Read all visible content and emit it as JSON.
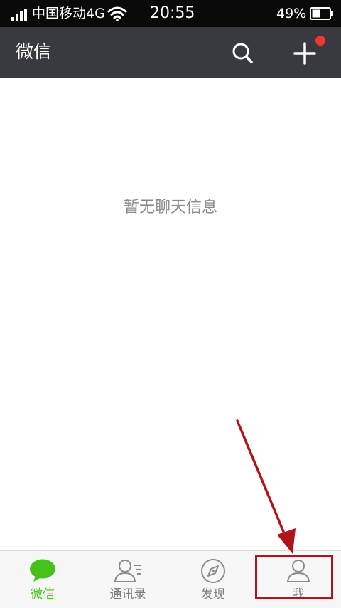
{
  "status_bar": {
    "carrier": "中国移动4G",
    "time": "20:55",
    "battery_percent": "49%",
    "battery_level": 0.49,
    "icons": [
      "signal-icon",
      "wifi-icon",
      "battery-icon"
    ]
  },
  "header": {
    "title": "微信",
    "icons": [
      "search-icon",
      "plus-icon"
    ],
    "notification_dot_color": "#f43530",
    "background": "#393a3f"
  },
  "main": {
    "empty_message": "暂无聊天信息"
  },
  "tab_bar": {
    "tabs": [
      {
        "label": "微信",
        "icon": "chat-bubble-icon",
        "active": true
      },
      {
        "label": "通讯录",
        "icon": "contacts-icon",
        "active": false
      },
      {
        "label": "发现",
        "icon": "compass-icon",
        "active": false
      },
      {
        "label": "我",
        "icon": "person-icon",
        "active": false
      }
    ],
    "active_color": "#46c01b",
    "inactive_color": "#7d7d7d"
  },
  "annotation": {
    "highlight_color": "#b0141a",
    "target": "tab-me"
  }
}
